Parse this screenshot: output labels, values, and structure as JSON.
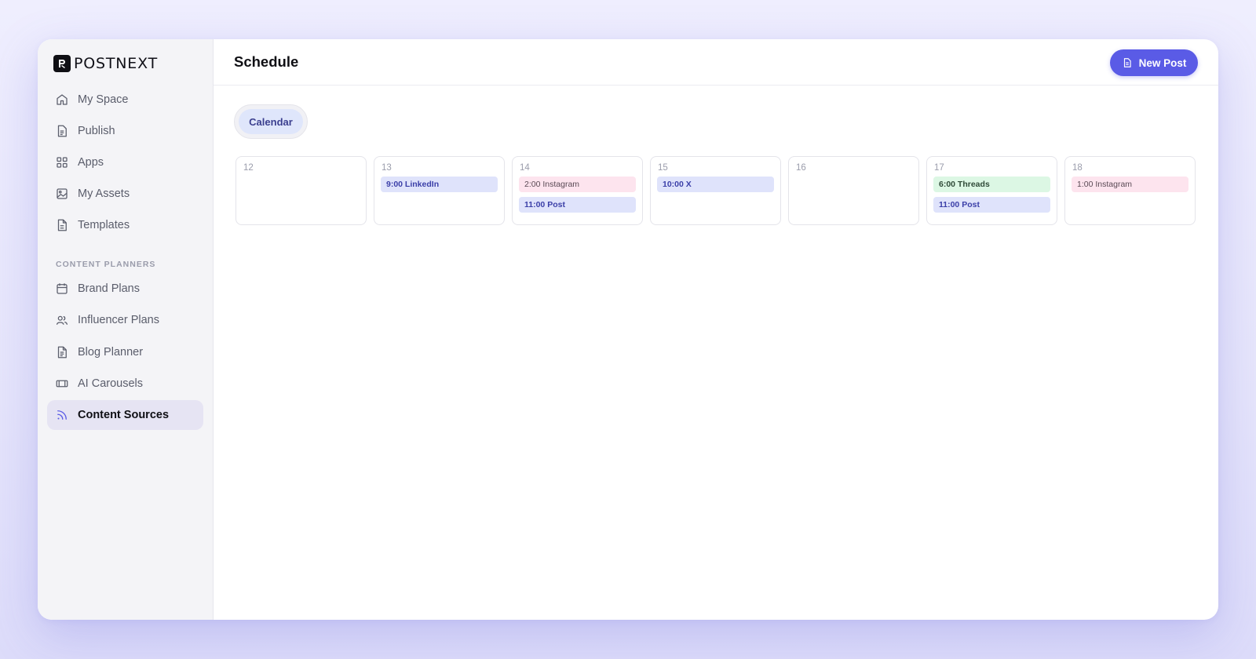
{
  "brand": {
    "name": "POSTNEXT",
    "logo_icon": "postnext-logo-icon"
  },
  "sidebar": {
    "items": [
      {
        "label": "My Space",
        "icon": "home-icon"
      },
      {
        "label": "Publish",
        "icon": "document-icon"
      },
      {
        "label": "Apps",
        "icon": "grid-icon"
      },
      {
        "label": "My Assets",
        "icon": "image-icon"
      },
      {
        "label": "Templates",
        "icon": "file-icon"
      }
    ],
    "section_label": "CONTENT PLANNERS",
    "planner_items": [
      {
        "label": "Brand Plans",
        "icon": "calendar-icon"
      },
      {
        "label": "Influencer Plans",
        "icon": "users-icon"
      },
      {
        "label": "Blog Planner",
        "icon": "file-text-icon"
      },
      {
        "label": "AI Carousels",
        "icon": "carousel-icon"
      },
      {
        "label": "Content Sources",
        "icon": "rss-icon",
        "active": true
      }
    ]
  },
  "header": {
    "title": "Schedule",
    "new_post_label": "New Post"
  },
  "tabs": {
    "active": "Calendar"
  },
  "calendar": {
    "days": [
      {
        "day": "12",
        "events": []
      },
      {
        "day": "13",
        "events": [
          {
            "label": "9:00 LinkedIn",
            "kind": "blue"
          }
        ]
      },
      {
        "day": "14",
        "events": [
          {
            "label": "2:00 Instagram",
            "kind": "pink"
          },
          {
            "label": "11:00 Post",
            "kind": "blue"
          }
        ]
      },
      {
        "day": "15",
        "events": [
          {
            "label": "10:00 X",
            "kind": "blue"
          }
        ]
      },
      {
        "day": "16",
        "events": []
      },
      {
        "day": "17",
        "events": [
          {
            "label": "6:00 Threads",
            "kind": "green"
          },
          {
            "label": "11:00 Post",
            "kind": "blue"
          }
        ]
      },
      {
        "day": "18",
        "events": [
          {
            "label": "1:00 Instagram",
            "kind": "pink"
          }
        ]
      }
    ]
  },
  "colors": {
    "accent": "#5a5be6",
    "active_nav_bg": "#e6e4f3",
    "event_blue": "#dfe3fb",
    "event_pink": "#fde4ee",
    "event_green": "#dcf7e4"
  }
}
